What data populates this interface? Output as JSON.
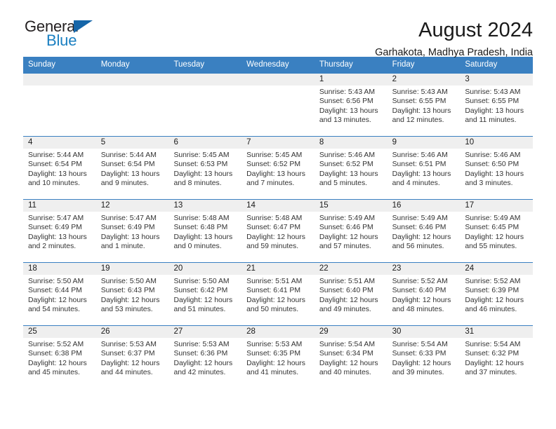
{
  "brand": {
    "name_part1": "General",
    "name_part2": "Blue",
    "accent_color": "#1a7fc1",
    "triangle_color": "#1565a8"
  },
  "header": {
    "title": "August 2024",
    "subtitle": "Garhakota, Madhya Pradesh, India"
  },
  "calendar": {
    "header_bg": "#3a80c1",
    "daynum_bg": "#efefef",
    "weekdays": [
      "Sunday",
      "Monday",
      "Tuesday",
      "Wednesday",
      "Thursday",
      "Friday",
      "Saturday"
    ],
    "weeks": [
      [
        {
          "day": "",
          "sunrise": "",
          "sunset": "",
          "daylight1": "",
          "daylight2": ""
        },
        {
          "day": "",
          "sunrise": "",
          "sunset": "",
          "daylight1": "",
          "daylight2": ""
        },
        {
          "day": "",
          "sunrise": "",
          "sunset": "",
          "daylight1": "",
          "daylight2": ""
        },
        {
          "day": "",
          "sunrise": "",
          "sunset": "",
          "daylight1": "",
          "daylight2": ""
        },
        {
          "day": "1",
          "sunrise": "Sunrise: 5:43 AM",
          "sunset": "Sunset: 6:56 PM",
          "daylight1": "Daylight: 13 hours",
          "daylight2": "and 13 minutes."
        },
        {
          "day": "2",
          "sunrise": "Sunrise: 5:43 AM",
          "sunset": "Sunset: 6:55 PM",
          "daylight1": "Daylight: 13 hours",
          "daylight2": "and 12 minutes."
        },
        {
          "day": "3",
          "sunrise": "Sunrise: 5:43 AM",
          "sunset": "Sunset: 6:55 PM",
          "daylight1": "Daylight: 13 hours",
          "daylight2": "and 11 minutes."
        }
      ],
      [
        {
          "day": "4",
          "sunrise": "Sunrise: 5:44 AM",
          "sunset": "Sunset: 6:54 PM",
          "daylight1": "Daylight: 13 hours",
          "daylight2": "and 10 minutes."
        },
        {
          "day": "5",
          "sunrise": "Sunrise: 5:44 AM",
          "sunset": "Sunset: 6:54 PM",
          "daylight1": "Daylight: 13 hours",
          "daylight2": "and 9 minutes."
        },
        {
          "day": "6",
          "sunrise": "Sunrise: 5:45 AM",
          "sunset": "Sunset: 6:53 PM",
          "daylight1": "Daylight: 13 hours",
          "daylight2": "and 8 minutes."
        },
        {
          "day": "7",
          "sunrise": "Sunrise: 5:45 AM",
          "sunset": "Sunset: 6:52 PM",
          "daylight1": "Daylight: 13 hours",
          "daylight2": "and 7 minutes."
        },
        {
          "day": "8",
          "sunrise": "Sunrise: 5:46 AM",
          "sunset": "Sunset: 6:52 PM",
          "daylight1": "Daylight: 13 hours",
          "daylight2": "and 5 minutes."
        },
        {
          "day": "9",
          "sunrise": "Sunrise: 5:46 AM",
          "sunset": "Sunset: 6:51 PM",
          "daylight1": "Daylight: 13 hours",
          "daylight2": "and 4 minutes."
        },
        {
          "day": "10",
          "sunrise": "Sunrise: 5:46 AM",
          "sunset": "Sunset: 6:50 PM",
          "daylight1": "Daylight: 13 hours",
          "daylight2": "and 3 minutes."
        }
      ],
      [
        {
          "day": "11",
          "sunrise": "Sunrise: 5:47 AM",
          "sunset": "Sunset: 6:49 PM",
          "daylight1": "Daylight: 13 hours",
          "daylight2": "and 2 minutes."
        },
        {
          "day": "12",
          "sunrise": "Sunrise: 5:47 AM",
          "sunset": "Sunset: 6:49 PM",
          "daylight1": "Daylight: 13 hours",
          "daylight2": "and 1 minute."
        },
        {
          "day": "13",
          "sunrise": "Sunrise: 5:48 AM",
          "sunset": "Sunset: 6:48 PM",
          "daylight1": "Daylight: 13 hours",
          "daylight2": "and 0 minutes."
        },
        {
          "day": "14",
          "sunrise": "Sunrise: 5:48 AM",
          "sunset": "Sunset: 6:47 PM",
          "daylight1": "Daylight: 12 hours",
          "daylight2": "and 59 minutes."
        },
        {
          "day": "15",
          "sunrise": "Sunrise: 5:49 AM",
          "sunset": "Sunset: 6:46 PM",
          "daylight1": "Daylight: 12 hours",
          "daylight2": "and 57 minutes."
        },
        {
          "day": "16",
          "sunrise": "Sunrise: 5:49 AM",
          "sunset": "Sunset: 6:46 PM",
          "daylight1": "Daylight: 12 hours",
          "daylight2": "and 56 minutes."
        },
        {
          "day": "17",
          "sunrise": "Sunrise: 5:49 AM",
          "sunset": "Sunset: 6:45 PM",
          "daylight1": "Daylight: 12 hours",
          "daylight2": "and 55 minutes."
        }
      ],
      [
        {
          "day": "18",
          "sunrise": "Sunrise: 5:50 AM",
          "sunset": "Sunset: 6:44 PM",
          "daylight1": "Daylight: 12 hours",
          "daylight2": "and 54 minutes."
        },
        {
          "day": "19",
          "sunrise": "Sunrise: 5:50 AM",
          "sunset": "Sunset: 6:43 PM",
          "daylight1": "Daylight: 12 hours",
          "daylight2": "and 53 minutes."
        },
        {
          "day": "20",
          "sunrise": "Sunrise: 5:50 AM",
          "sunset": "Sunset: 6:42 PM",
          "daylight1": "Daylight: 12 hours",
          "daylight2": "and 51 minutes."
        },
        {
          "day": "21",
          "sunrise": "Sunrise: 5:51 AM",
          "sunset": "Sunset: 6:41 PM",
          "daylight1": "Daylight: 12 hours",
          "daylight2": "and 50 minutes."
        },
        {
          "day": "22",
          "sunrise": "Sunrise: 5:51 AM",
          "sunset": "Sunset: 6:40 PM",
          "daylight1": "Daylight: 12 hours",
          "daylight2": "and 49 minutes."
        },
        {
          "day": "23",
          "sunrise": "Sunrise: 5:52 AM",
          "sunset": "Sunset: 6:40 PM",
          "daylight1": "Daylight: 12 hours",
          "daylight2": "and 48 minutes."
        },
        {
          "day": "24",
          "sunrise": "Sunrise: 5:52 AM",
          "sunset": "Sunset: 6:39 PM",
          "daylight1": "Daylight: 12 hours",
          "daylight2": "and 46 minutes."
        }
      ],
      [
        {
          "day": "25",
          "sunrise": "Sunrise: 5:52 AM",
          "sunset": "Sunset: 6:38 PM",
          "daylight1": "Daylight: 12 hours",
          "daylight2": "and 45 minutes."
        },
        {
          "day": "26",
          "sunrise": "Sunrise: 5:53 AM",
          "sunset": "Sunset: 6:37 PM",
          "daylight1": "Daylight: 12 hours",
          "daylight2": "and 44 minutes."
        },
        {
          "day": "27",
          "sunrise": "Sunrise: 5:53 AM",
          "sunset": "Sunset: 6:36 PM",
          "daylight1": "Daylight: 12 hours",
          "daylight2": "and 42 minutes."
        },
        {
          "day": "28",
          "sunrise": "Sunrise: 5:53 AM",
          "sunset": "Sunset: 6:35 PM",
          "daylight1": "Daylight: 12 hours",
          "daylight2": "and 41 minutes."
        },
        {
          "day": "29",
          "sunrise": "Sunrise: 5:54 AM",
          "sunset": "Sunset: 6:34 PM",
          "daylight1": "Daylight: 12 hours",
          "daylight2": "and 40 minutes."
        },
        {
          "day": "30",
          "sunrise": "Sunrise: 5:54 AM",
          "sunset": "Sunset: 6:33 PM",
          "daylight1": "Daylight: 12 hours",
          "daylight2": "and 39 minutes."
        },
        {
          "day": "31",
          "sunrise": "Sunrise: 5:54 AM",
          "sunset": "Sunset: 6:32 PM",
          "daylight1": "Daylight: 12 hours",
          "daylight2": "and 37 minutes."
        }
      ]
    ]
  }
}
